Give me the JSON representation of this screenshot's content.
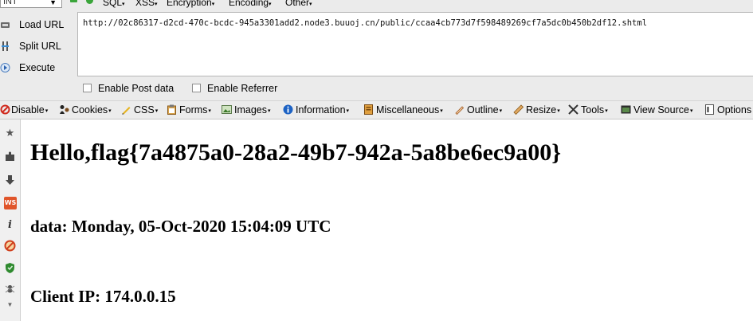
{
  "hackbar": {
    "int_select": "INT",
    "menu": [
      "SQL",
      "XSS",
      "Encryption",
      "Encoding",
      "Other"
    ],
    "load_url": "Load URL",
    "split_url": "Split URL",
    "execute": "Execute",
    "url": "http://02c86317-d2cd-470c-bcdc-945a3301add2.node3.buuoj.cn/public/ccaa4cb773d7f598489269cf7a5dc0b450b2df12.shtml",
    "enable_post": "Enable Post data",
    "enable_referrer": "Enable Referrer"
  },
  "toolbar": {
    "disable": "Disable",
    "cookies": "Cookies",
    "css": "CSS",
    "forms": "Forms",
    "images": "Images",
    "information": "Information",
    "miscellaneous": "Miscellaneous",
    "outline": "Outline",
    "resize": "Resize",
    "tools": "Tools",
    "view_source": "View Source",
    "options": "Options",
    "dropdown_glyph": "▾"
  },
  "sidebar": {
    "icons": [
      "star-icon",
      "puzzle-icon",
      "download-arrow-icon",
      "ws-icon",
      "info-icon",
      "block-icon",
      "shield-icon",
      "ant-icon"
    ],
    "ws_label": "WS"
  },
  "content": {
    "heading": "Hello,flag{7a4875a0-28a2-49b7-942a-5a8be6ec9a00}",
    "date_line": "data: Monday, 05-Oct-2020 15:04:09 UTC",
    "ip_line": "Client IP: 174.0.0.15"
  },
  "colors": {
    "panel_bg": "#ebebeb",
    "page_bg": "#ffffff",
    "green_icon": "#3aa53a",
    "info_blue": "#1e63c4",
    "disable_red": "#d02a1e"
  }
}
